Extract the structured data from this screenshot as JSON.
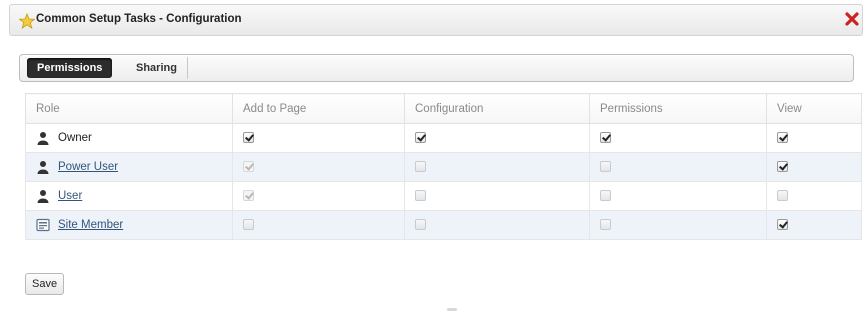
{
  "dialog": {
    "title": "Common Setup Tasks - Configuration",
    "icon": "star-icon",
    "close_icon": "close-icon"
  },
  "tabs": [
    {
      "label": "Permissions",
      "active": true
    },
    {
      "label": "Sharing",
      "active": false
    }
  ],
  "grid": {
    "columns": [
      "Role",
      "Add to Page",
      "Configuration",
      "Permissions",
      "View"
    ],
    "rows": [
      {
        "role": "Owner",
        "icon": "user-icon",
        "link": false,
        "add_to_page": "checked",
        "configuration": "checked",
        "permissions": "checked",
        "view": "checked"
      },
      {
        "role": "Power User",
        "icon": "user-icon",
        "link": true,
        "add_to_page": "checked-disabled",
        "configuration": "unchecked",
        "permissions": "unchecked",
        "view": "checked"
      },
      {
        "role": "User",
        "icon": "user-icon",
        "link": true,
        "add_to_page": "checked-disabled",
        "configuration": "unchecked",
        "permissions": "unchecked",
        "view": "unchecked"
      },
      {
        "role": "Site Member",
        "icon": "site-member-icon",
        "link": true,
        "add_to_page": "unchecked",
        "configuration": "unchecked",
        "permissions": "unchecked",
        "view": "checked"
      }
    ]
  },
  "actions": {
    "save_label": "Save"
  },
  "colors": {
    "active_tab": "#2c2c2c",
    "close": "#cc2222",
    "link": "#33557a",
    "alt_row": "#eef3fa"
  }
}
